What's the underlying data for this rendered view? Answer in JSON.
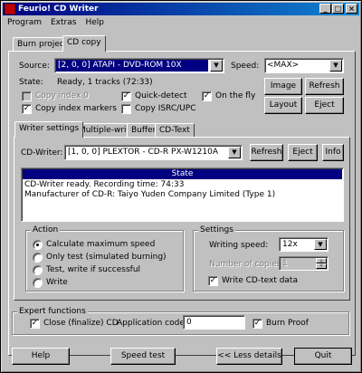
{
  "window": {
    "title": "Feurio! CD Writer"
  },
  "titlebar_buttons": {
    "minimize": "_",
    "maximize": "□",
    "close": "×"
  },
  "menu": [
    "Program",
    "Extras",
    "Help"
  ],
  "top_tabs": [
    "Burn project",
    "CD copy"
  ],
  "source": {
    "label": "Source:",
    "value": "[2, 0, 0]  ATAPI - DVD-ROM 10X"
  },
  "speed": {
    "label": "Speed:",
    "value": "<MAX>"
  },
  "state": {
    "label": "State:",
    "value": "Ready, 1 tracks (72:33)"
  },
  "copy_options": {
    "copy_index0": "Copy index 0",
    "copy_index_markers": "Copy index markers",
    "quick_detect": "Quick-detect",
    "copy_isrc": "Copy ISRC/UPC",
    "on_the_fly": "On the fly"
  },
  "right_buttons": {
    "image": "Image",
    "refresh": "Refresh",
    "layout": "Layout",
    "eject": "Eject"
  },
  "inner_tabs": [
    "Writer settings",
    "Multiple-write",
    "Buffer",
    "CD-Text"
  ],
  "writer": {
    "label": "CD-Writer:",
    "value": "[1, 0, 0]  PLEXTOR - CD-R   PX-W1210A",
    "refresh": "Refresh",
    "eject": "Eject",
    "info": "Info"
  },
  "state_box": {
    "header": "State",
    "lines": [
      "CD-Writer ready. Recording time: 74:33",
      "Manufacturer of CD-R: Taiyo Yuden Company Limited (Type 1)"
    ]
  },
  "action": {
    "title": "Action",
    "options": [
      "Calculate maximum speed",
      "Only test (simulated burning)",
      "Test, write if successful",
      "Write"
    ],
    "selected": 0
  },
  "settings": {
    "title": "Settings",
    "writing_speed_label": "Writing speed:",
    "writing_speed_value": "12x",
    "copies_label": "Number of copies:",
    "copies_value": "1",
    "write_cdtext": "Write CD-text data"
  },
  "expert": {
    "title": "Expert functions",
    "close_cd": "Close (finalize) CD",
    "app_code_label": "Application code:",
    "app_code_value": "0",
    "burn_proof": "Burn Proof"
  },
  "bottom_buttons": {
    "help": "Help",
    "speed_test": "Speed test",
    "less_details": "<< Less details",
    "quit": "Quit"
  },
  "colors": {
    "selection": "#000080",
    "face": "#c0c0c0"
  }
}
